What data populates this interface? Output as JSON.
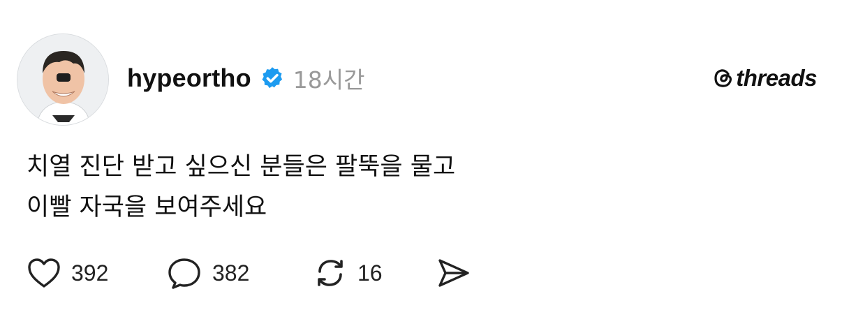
{
  "post": {
    "author": {
      "username": "hypeortho",
      "verified_icon": "verified-badge-icon",
      "avatar_icon": "avatar"
    },
    "timestamp": "18시간",
    "brand": {
      "icon": "threads-logo-icon",
      "label": "threads"
    },
    "content_lines": [
      "치열 진단 받고 싶으신 분들은 팔뚝을 물고",
      "이빨 자국을 보여주세요"
    ],
    "actions": {
      "like": {
        "icon": "heart-icon",
        "count": "392"
      },
      "comment": {
        "icon": "comment-icon",
        "count": "382"
      },
      "repost": {
        "icon": "repost-icon",
        "count": "16"
      },
      "share": {
        "icon": "send-icon"
      }
    }
  },
  "colors": {
    "text": "#111111",
    "timestamp": "#999999",
    "verified": "#1d9bf0",
    "icon_stroke": "#222222"
  }
}
